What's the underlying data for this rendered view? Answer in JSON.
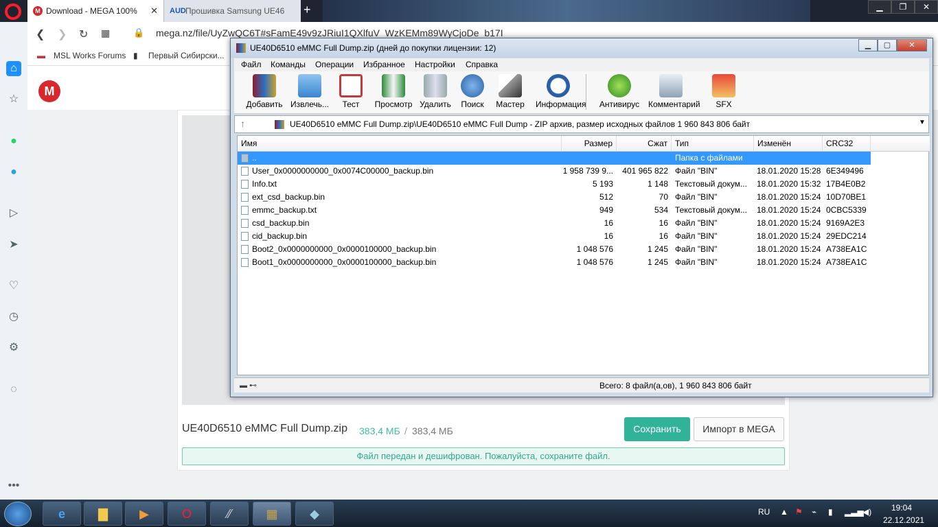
{
  "browser": {
    "tabs": [
      {
        "label": "Download - MEGA 100%",
        "icon": "mega-icon"
      },
      {
        "label": "Прошивка Samsung UE46",
        "icon": "aud-icon"
      }
    ],
    "url": "mega.nz/file/UyZwQC6T#sFamE49v9zJRiuI1QXlfuV_WzKEMm89WyCjoDe_b17I",
    "bookmarks": [
      "MSL Works Forums",
      "Первый Сибирски..."
    ]
  },
  "mega": {
    "filename": "UE40D6510 eMMC Full Dump.zip",
    "size_done": "383,4 МБ",
    "size_sep": "/",
    "size_total": "383,4 МБ",
    "save_label": "Сохранить",
    "import_label": "Импорт в MEGA",
    "status": "Файл передан и дешифрован. Пожалуйста, сохраните файл."
  },
  "rar": {
    "title": "UE40D6510 eMMC Full Dump.zip (дней до покупки лицензии: 12)",
    "menu": [
      "Файл",
      "Команды",
      "Операции",
      "Избранное",
      "Настройки",
      "Справка"
    ],
    "toolbar": [
      "Добавить",
      "Извлечь...",
      "Тест",
      "Просмотр",
      "Удалить",
      "Поиск",
      "Мастер",
      "Информация",
      "Антивирус",
      "Комментарий",
      "SFX"
    ],
    "path": "UE40D6510 eMMC Full Dump.zip\\UE40D6510 eMMC Full Dump - ZIP архив, размер исходных файлов 1 960 843 806 байт",
    "columns": {
      "name": "Имя",
      "size": "Размер",
      "packed": "Сжат",
      "type": "Тип",
      "modified": "Изменён",
      "crc": "CRC32"
    },
    "rows": [
      {
        "name": "..",
        "size": "",
        "packed": "",
        "type": "Папка с файлами",
        "modified": "",
        "crc": ""
      },
      {
        "name": "User_0x0000000000_0x0074C00000_backup.bin",
        "size": "1 958 739 9...",
        "packed": "401 965 822",
        "type": "Файл \"BIN\"",
        "modified": "18.01.2020 15:28",
        "crc": "6E349496"
      },
      {
        "name": "Info.txt",
        "size": "5 193",
        "packed": "1 148",
        "type": "Текстовый докум...",
        "modified": "18.01.2020 15:32",
        "crc": "17B4E0B2"
      },
      {
        "name": "ext_csd_backup.bin",
        "size": "512",
        "packed": "70",
        "type": "Файл \"BIN\"",
        "modified": "18.01.2020 15:24",
        "crc": "10D70BE1"
      },
      {
        "name": "emmc_backup.txt",
        "size": "949",
        "packed": "534",
        "type": "Текстовый докум...",
        "modified": "18.01.2020 15:24",
        "crc": "0CBC5339"
      },
      {
        "name": "csd_backup.bin",
        "size": "16",
        "packed": "16",
        "type": "Файл \"BIN\"",
        "modified": "18.01.2020 15:24",
        "crc": "9169A2E3"
      },
      {
        "name": "cid_backup.bin",
        "size": "16",
        "packed": "16",
        "type": "Файл \"BIN\"",
        "modified": "18.01.2020 15:24",
        "crc": "29EDC214"
      },
      {
        "name": "Boot2_0x0000000000_0x0000100000_backup.bin",
        "size": "1 048 576",
        "packed": "1 245",
        "type": "Файл \"BIN\"",
        "modified": "18.01.2020 15:24",
        "crc": "A738EA1C"
      },
      {
        "name": "Boot1_0x0000000000_0x0000100000_backup.bin",
        "size": "1 048 576",
        "packed": "1 245",
        "type": "Файл \"BIN\"",
        "modified": "18.01.2020 15:24",
        "crc": "A738EA1C"
      }
    ],
    "status": "Всего: 8 файл(а,ов), 1 960 843 806 байт"
  },
  "taskbar": {
    "lang": "RU",
    "time": "19:04",
    "date": "22.12.2021"
  },
  "colors": {
    "mega_red": "#d9272e",
    "mega_green": "#31b39a",
    "selection": "#3399ff"
  }
}
